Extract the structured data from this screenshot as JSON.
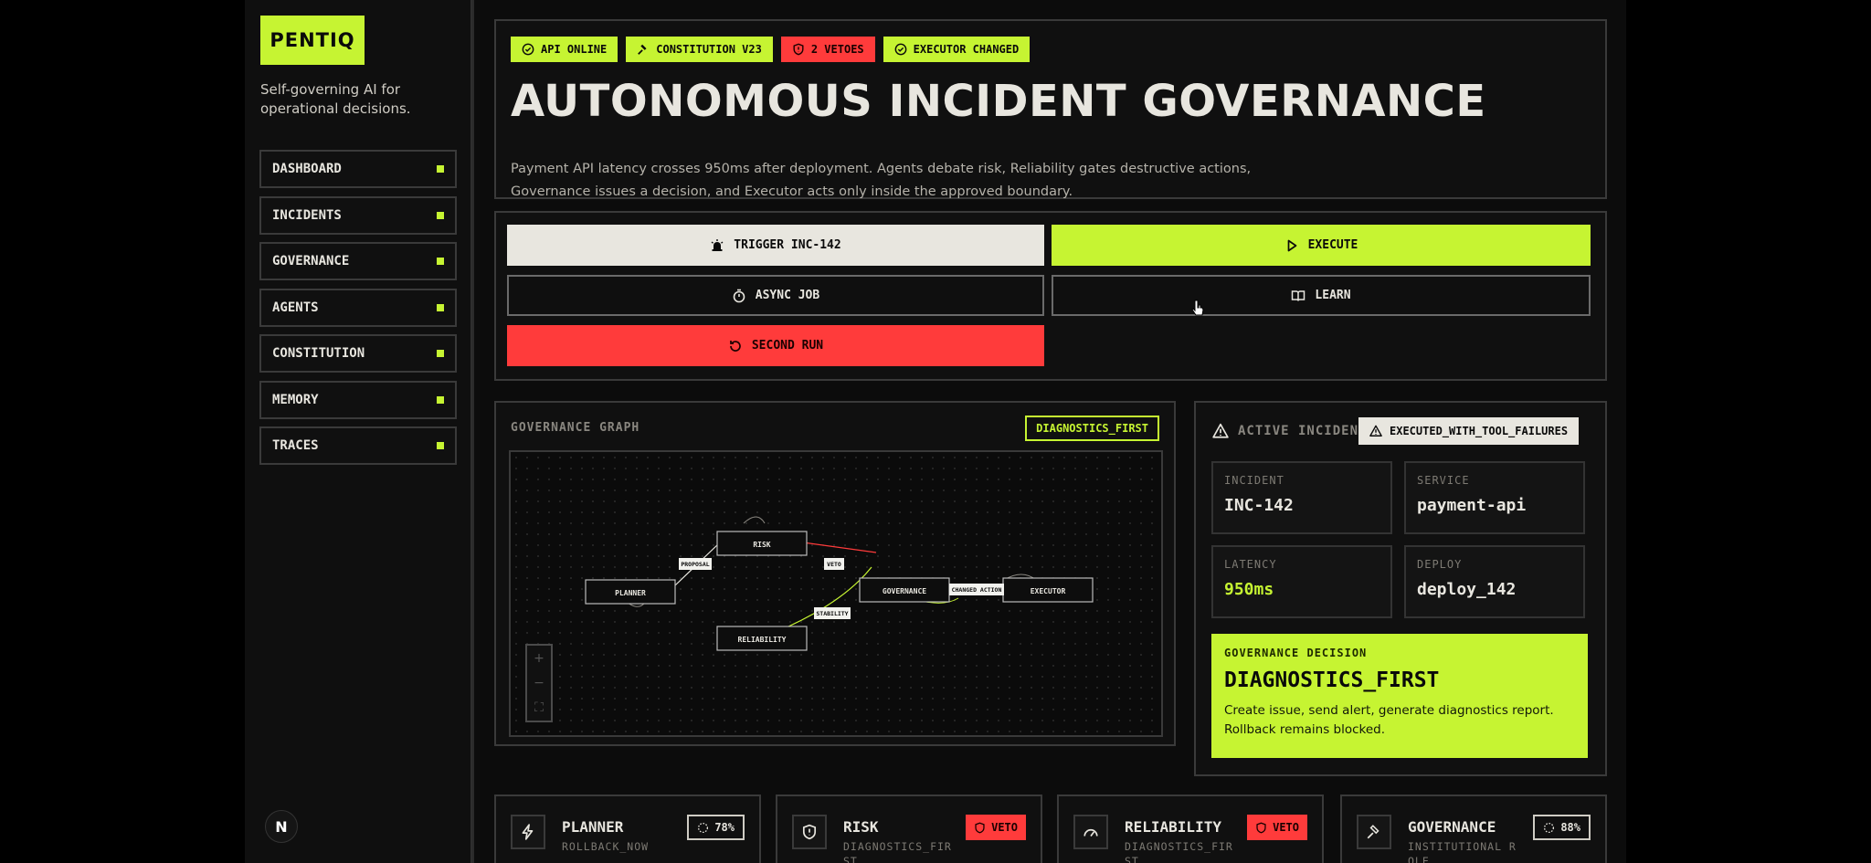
{
  "brand": {
    "logo": "PENTIQ",
    "tagline": "Self-governing AI for operational decisions."
  },
  "nav": {
    "items": [
      {
        "label": "DASHBOARD"
      },
      {
        "label": "INCIDENTS"
      },
      {
        "label": "GOVERNANCE"
      },
      {
        "label": "AGENTS"
      },
      {
        "label": "CONSTITUTION"
      },
      {
        "label": "MEMORY"
      },
      {
        "label": "TRACES"
      }
    ],
    "footer_icon": "N"
  },
  "hero": {
    "badges": [
      {
        "label": "API ONLINE",
        "icon": "check-circle-icon"
      },
      {
        "label": "CONSTITUTION V23",
        "icon": "gavel-icon"
      },
      {
        "label": "2 VETOES",
        "icon": "shield-icon"
      },
      {
        "label": "EXECUTOR CHANGED",
        "icon": "check-circle-icon"
      }
    ],
    "title": "AUTONOMOUS INCIDENT GOVERNANCE",
    "description": "Payment API latency crosses 950ms after deployment. Agents debate risk, Reliability gates destructive actions, Governance issues a decision, and Executor acts only inside the approved boundary."
  },
  "controls": {
    "trigger": "TRIGGER INC-142",
    "execute": "EXECUTE",
    "async": "ASYNC JOB",
    "learn": "LEARN",
    "second_run": "SECOND RUN"
  },
  "graph": {
    "title": "GOVERNANCE GRAPH",
    "tag": "DIAGNOSTICS_FIRST",
    "nodes": {
      "planner": "PLANNER",
      "risk": "RISK",
      "reliability": "RELIABILITY",
      "governance": "GOVERNANCE",
      "executor": "EXECUTOR"
    },
    "edges": {
      "proposal": "PROPOSAL",
      "veto": "VETO",
      "stability": "STABILITY",
      "changed_action": "CHANGED ACTION"
    },
    "zoom": {
      "in": "+",
      "out": "−",
      "fit": "⛶"
    }
  },
  "incident": {
    "header": "ACTIVE INCIDENT",
    "status": "EXECUTED_WITH_TOOL_FAILURES",
    "fields": {
      "incident": {
        "key": "INCIDENT",
        "value": "INC-142"
      },
      "service": {
        "key": "SERVICE",
        "value": "payment-api"
      },
      "latency": {
        "key": "LATENCY",
        "value": "950ms"
      },
      "deploy": {
        "key": "DEPLOY",
        "value": "deploy_142"
      }
    },
    "decision": {
      "key": "GOVERNANCE DECISION",
      "value": "DIAGNOSTICS_FIRST",
      "description": "Create issue, send alert, generate diagnostics report. Rollback remains blocked."
    }
  },
  "agents": [
    {
      "name": "PLANNER",
      "sub": "ROLLBACK_NOW",
      "pill": "78%",
      "icon": "bolt-icon"
    },
    {
      "name": "RISK",
      "sub": "DIAGNOSTICS_FIRST",
      "pill": "VETO",
      "icon": "shield-icon"
    },
    {
      "name": "RELIABILITY",
      "sub": "DIAGNOSTICS_FIRST",
      "pill": "VETO",
      "icon": "gauge-icon"
    },
    {
      "name": "GOVERNANCE",
      "sub": "INSTITUTIONAL ROLE",
      "pill": "88%",
      "icon": "gavel-icon"
    }
  ],
  "colors": {
    "accent": "#c6f432",
    "danger": "#ff3b3b",
    "light": "#e8e6df",
    "background": "#0c0c0c"
  }
}
